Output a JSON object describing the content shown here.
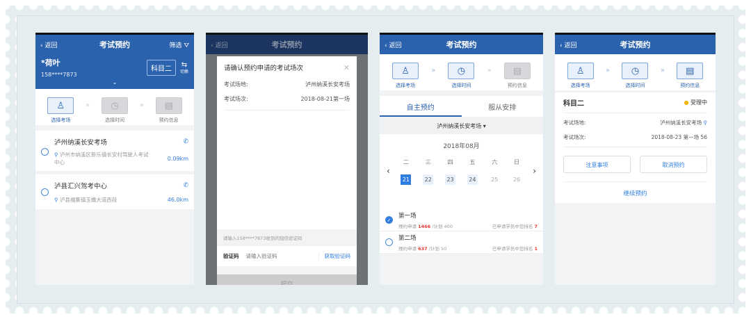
{
  "common": {
    "back": "返回",
    "title": "考试预约",
    "steps": [
      "选择考场",
      "选择时间",
      "预约信息"
    ]
  },
  "p1": {
    "filter": "筛选",
    "name": "*荷叶",
    "phone": "158****7873",
    "subject": "科目二",
    "switch": "切换",
    "venues": [
      {
        "name": "泸州纳溪长安考场",
        "addr": "泸州市纳溪区新乐镇长安村驾驶人考试中心",
        "dist": "0.09km"
      },
      {
        "name": "泸县汇兴驾考中心",
        "addr": "泸县福集镇玉蟾大道西段",
        "dist": "46.0km"
      }
    ]
  },
  "p2": {
    "modal_title": "请确认预约申请的考试场次",
    "venue_label": "考试场地:",
    "venue": "泸州纳溪长安考场",
    "session_label": "考试场次:",
    "session": "2018-08-21第一场",
    "sms_hint": "请输入158****7873收到的短信验证码",
    "code_label": "验证码",
    "code_placeholder": "请输入验证码",
    "get_code": "获取验证码",
    "submit": "提交"
  },
  "p3": {
    "tabs": [
      "自主预约",
      "服从安排"
    ],
    "venue": "泸州纳溪长安考场",
    "month": "2018年08月",
    "weekdays": [
      "二",
      "三",
      "四",
      "五",
      "六",
      "日"
    ],
    "dates": [
      "21",
      "22",
      "23",
      "24",
      "25",
      "26"
    ],
    "sessions": [
      {
        "name": "第一场",
        "applied_label": "预约申请",
        "applied": "1466",
        "plan": "/计划 400",
        "rank_label": "已申请学员中您排名",
        "rank": "7"
      },
      {
        "name": "第二场",
        "applied_label": "预约申请",
        "applied": "637",
        "plan": "/计划 50",
        "rank_label": "已申请学员中您排名",
        "rank": "1"
      }
    ]
  },
  "p4": {
    "subject": "科目二",
    "status": "受理中",
    "venue_label": "考试场地:",
    "venue": "泸州纳溪长安考场",
    "session_label": "考试场次:",
    "session": "2018-08-23 第一场 56",
    "notice": "注意事项",
    "cancel": "取消预约",
    "continue": "继续预约"
  }
}
